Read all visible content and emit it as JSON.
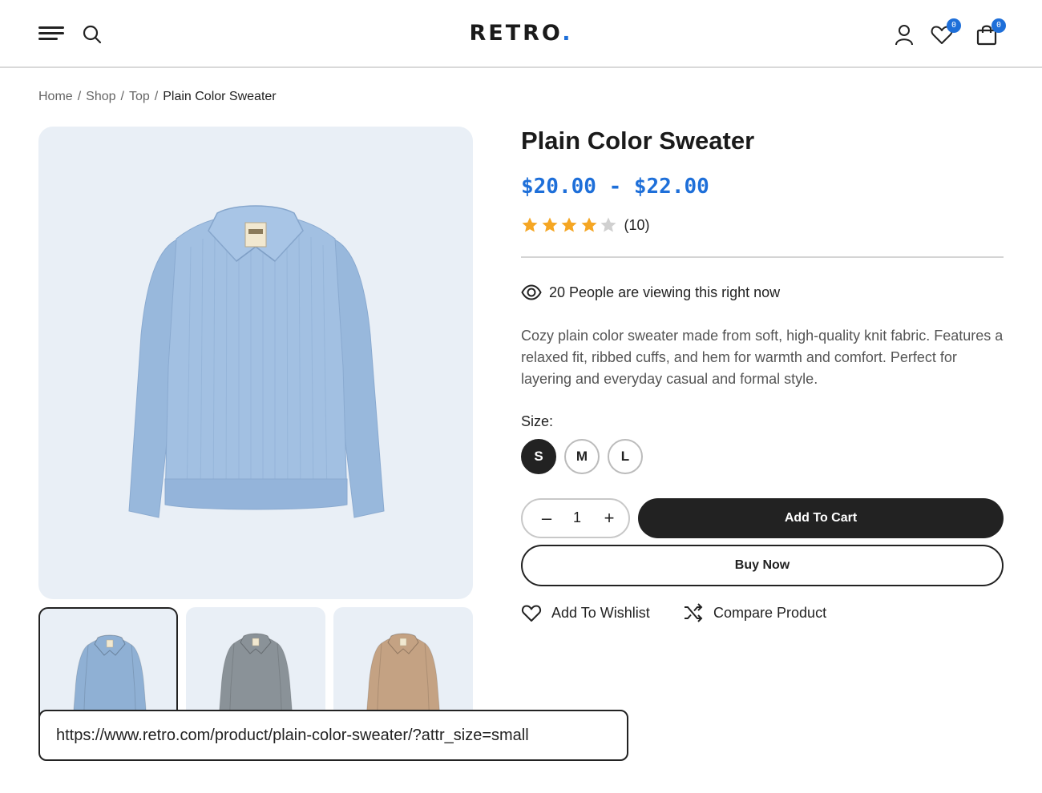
{
  "header": {
    "logo_text": "RETRO",
    "logo_dot": ".",
    "wishlist_count": "0",
    "cart_count": "0"
  },
  "breadcrumb": {
    "items": [
      "Home",
      "Shop",
      "Top"
    ],
    "separator": "/",
    "current": "Plain Color Sweater"
  },
  "product": {
    "title": "Plain Color Sweater",
    "price": "$20.00 - $22.00",
    "rating": 4,
    "rating_max": 5,
    "review_count": "(10)",
    "viewing_text": "20 People are viewing this right now",
    "description": "Cozy plain color sweater made from soft, high-quality knit fabric. Features a relaxed fit, ribbed cuffs, and hem for warmth and comfort. Perfect for layering and everyday casual and formal style.",
    "size_label": "Size:",
    "sizes": [
      "S",
      "M",
      "L"
    ],
    "selected_size": "S",
    "quantity": "1",
    "qty_minus": "–",
    "qty_plus": "+"
  },
  "actions": {
    "add_to_cart": "Add To Cart",
    "buy_now": "Buy Now",
    "wishlist": "Add To Wishlist",
    "compare": "Compare Product"
  },
  "gallery": {
    "thumbnail_colors": [
      "#8fb0d4",
      "#8a9298",
      "#c4a283"
    ],
    "main_color": "#98b8dc",
    "background": "#e9eff6"
  },
  "status_url": "https://www.retro.com/product/plain-color-sweater/?attr_size=small",
  "colors": {
    "accent": "#1e6fd9",
    "star": "#f5a623",
    "star_empty": "#d0d0d0",
    "dark": "#222222"
  }
}
